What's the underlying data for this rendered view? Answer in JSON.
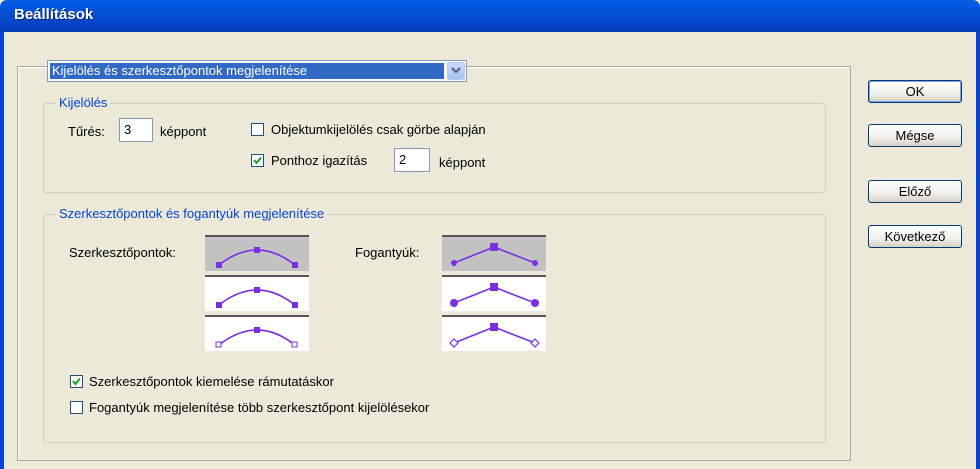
{
  "window": {
    "title": "Beállítások"
  },
  "panel_selector": {
    "selected": "Kijelölés és szerkesztőpontok megjelenítése"
  },
  "selection_group": {
    "legend": "Kijelölés",
    "tolerance_label": "Tűrés:",
    "tolerance_value": "3",
    "tolerance_unit": "képpont",
    "object_selection_label": "Objektumkijelölés csak görbe alapján",
    "object_selection_checked": false,
    "snap_label": "Ponthoz igazítás",
    "snap_checked": true,
    "snap_value": "2",
    "snap_unit": "képpont"
  },
  "anchor_group": {
    "legend": "Szerkesztőpontok és fogantyúk megjelenítése",
    "anchors_label": "Szerkesztőpontok:",
    "handles_label": "Fogantyúk:",
    "anchor_options": [
      "style-1",
      "style-2",
      "style-3"
    ],
    "handle_options": [
      "style-1",
      "style-2",
      "style-3"
    ],
    "selected_anchor": 0,
    "selected_handle": 0,
    "highlight_label": "Szerkesztőpontok kiemelése rámutatáskor",
    "highlight_checked": true,
    "show_handles_label": "Fogantyúk megjelenítése több szerkesztőpont kijelölésekor",
    "show_handles_checked": false
  },
  "buttons": {
    "ok": "OK",
    "cancel": "Mégse",
    "prev": "Előző",
    "next": "Következő"
  },
  "colors": {
    "title_bar": "#0a4fd2",
    "selection": "#316ac5",
    "accent": "#7a2fe0",
    "legend": "#0046d5"
  }
}
